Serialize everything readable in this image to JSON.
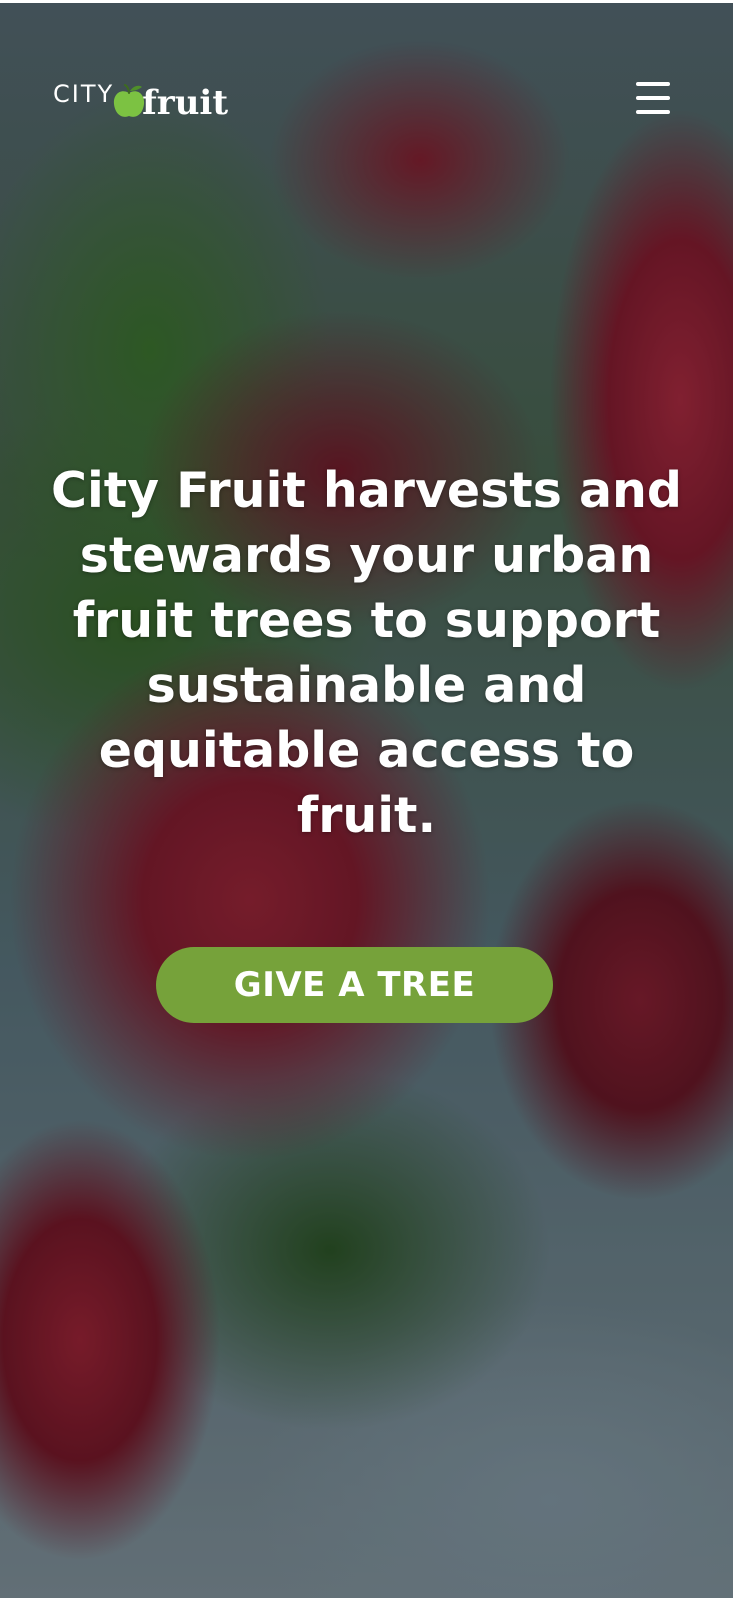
{
  "header": {
    "logo": {
      "text_city": "CITY",
      "text_fruit": "fruit",
      "icon": "apple-icon"
    },
    "menu_icon": "hamburger-menu-icon"
  },
  "hero": {
    "headline": "City Fruit harvests and stewards your urban fruit trees to support sustainable and equitable access to fruit.",
    "cta_label": "GIVE A TREE"
  },
  "colors": {
    "accent_green": "#76a23a",
    "logo_apple_green": "#7cc242",
    "text": "#ffffff"
  }
}
